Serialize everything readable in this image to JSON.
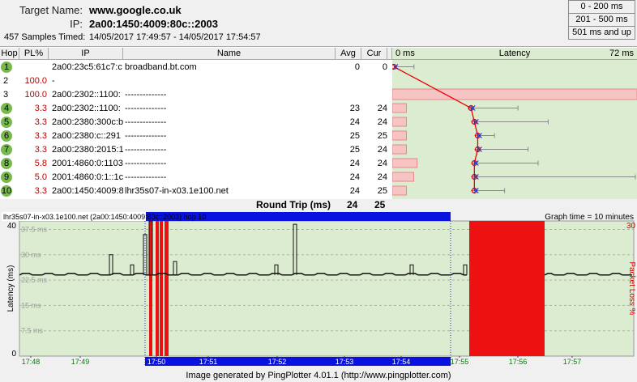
{
  "header": {
    "target_label": "Target Name:",
    "target_value": "www.google.co.uk",
    "ip_label": "IP:",
    "ip_value": "2a00:1450:4009:80c::2003",
    "samples_label": "457 Samples Timed:",
    "samples_value": "14/05/2017 17:49:57 - 14/05/2017 17:54:57"
  },
  "legend": [
    {
      "label": "0 - 200 ms",
      "color": "#a9d98b"
    },
    {
      "label": "201 - 500 ms",
      "color": "#f5b041"
    },
    {
      "label": "501 ms and up",
      "color": "#f24d4d"
    }
  ],
  "columns": {
    "hop": "Hop",
    "pl": "PL%",
    "ip": "IP",
    "name": "Name",
    "avg": "Avg",
    "cur": "Cur",
    "lat_min": "0 ms",
    "latency": "Latency",
    "lat_max": "72 ms"
  },
  "hops": [
    {
      "hop": "1",
      "pl": "",
      "ip": "2a00:23c5:61c7:c",
      "name": "broadband.bt.com",
      "avg": "0",
      "cur": "0",
      "green": true,
      "lat": 0,
      "min": 0,
      "max": 6,
      "loss": 0
    },
    {
      "hop": "2",
      "pl": "100.0",
      "ip": "-",
      "name": "",
      "avg": "",
      "cur": "",
      "green": false,
      "lat": null,
      "loss": 0
    },
    {
      "hop": "3",
      "pl": "100.0",
      "ip": "2a00:2302::1100:",
      "name": "--------------",
      "avg": "",
      "cur": "",
      "green": false,
      "lat": null,
      "loss": 100
    },
    {
      "hop": "4",
      "pl": "3.3",
      "ip": "2a00:2302::1100:",
      "name": "--------------",
      "avg": "23",
      "cur": "24",
      "green": true,
      "lat": 23,
      "min": 22,
      "max": 37,
      "loss": 3.3
    },
    {
      "hop": "5",
      "pl": "3.3",
      "ip": "2a00:2380:300c:b",
      "name": "--------------",
      "avg": "24",
      "cur": "24",
      "green": true,
      "lat": 24,
      "min": 23,
      "max": 46,
      "loss": 3.3
    },
    {
      "hop": "6",
      "pl": "3.3",
      "ip": "2a00:2380:c::291",
      "name": "--------------",
      "avg": "25",
      "cur": "25",
      "green": true,
      "lat": 25,
      "min": 24,
      "max": 30,
      "loss": 3.3
    },
    {
      "hop": "7",
      "pl": "3.3",
      "ip": "2a00:2380:2015:1",
      "name": "--------------",
      "avg": "25",
      "cur": "24",
      "green": true,
      "lat": 25,
      "min": 24,
      "max": 40,
      "loss": 3.3
    },
    {
      "hop": "8",
      "pl": "5.8",
      "ip": "2001:4860:0:1103",
      "name": "--------------",
      "avg": "24",
      "cur": "24",
      "green": true,
      "lat": 24,
      "min": 23,
      "max": 43,
      "loss": 5.8
    },
    {
      "hop": "9",
      "pl": "5.0",
      "ip": "2001:4860:0:1::1c",
      "name": "--------------",
      "avg": "24",
      "cur": "24",
      "green": true,
      "lat": 24,
      "min": 23,
      "max": 72,
      "loss": 5.0
    },
    {
      "hop": "10",
      "pl": "3.3",
      "ip": "2a00:1450:4009:8",
      "name": "lhr35s07-in-x03.1e100.net",
      "avg": "24",
      "cur": "25",
      "green": true,
      "lat": 24,
      "min": 23,
      "max": 33,
      "loss": 3.3
    }
  ],
  "round_trip": {
    "label": "Round Trip (ms)",
    "avg": "24",
    "cur": "25"
  },
  "graph": {
    "title": "lhr35s07-in-x03.1e100.net (2a00:1450:4009:80c::2003) hop 10",
    "time_label": "Graph time = 10 minutes",
    "y_axis_label": "Latency (ms)",
    "y2_axis_label": "Packet Loss %",
    "y_top": "40",
    "y_bottom": "0",
    "y2_top": "30",
    "gridlines": [
      "37.5 ms",
      "30 ms",
      "22.5 ms",
      "15 ms",
      "7.5 ms"
    ],
    "x_ticks": [
      "17:48",
      "17:49",
      "17:50",
      "17:51",
      "17:52",
      "17:53",
      "17:54",
      "17:55",
      "17:56",
      "17:57"
    ]
  },
  "footer": "Image generated by PingPlotter 4.01.1 (http://www.pingplotter.com)"
}
